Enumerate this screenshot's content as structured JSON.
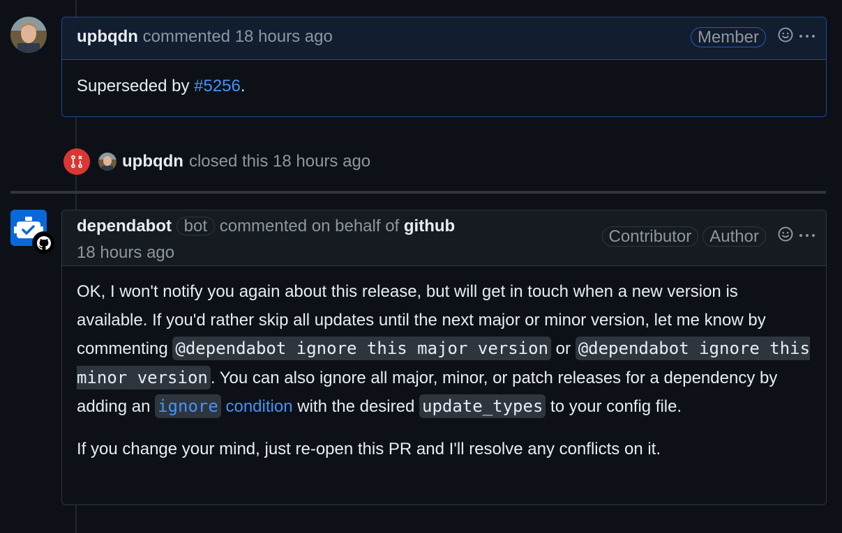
{
  "comment1": {
    "author": "upbqdn",
    "action": "commented",
    "time": "18 hours ago",
    "role": "Member",
    "body_prefix": "Superseded by ",
    "link": "#5256",
    "body_suffix": "."
  },
  "closed_event": {
    "author": "upbqdn",
    "text": "closed this 18 hours ago"
  },
  "comment2": {
    "author": "dependabot",
    "bot_label": "bot",
    "action": "commented on behalf of",
    "on_behalf": "github",
    "time": "18 hours ago",
    "role1": "Contributor",
    "role2": "Author",
    "para1": {
      "t1": "OK, I won't notify you again about this release, but will get in touch when a new version is available. If you'd rather skip all updates until the next major or minor version, let me know by commenting ",
      "code1": "@dependabot ignore this major version",
      "t2": " or ",
      "code2": "@dependabot ignore this minor version",
      "t3": ". You can also ignore all major, minor, or patch releases for a dependency by adding an ",
      "link_code": "ignore",
      "link_text": "condition",
      "t4": " with the desired ",
      "code3": "update_types",
      "t5": " to your config file."
    },
    "para2": "If you change your mind, just re-open this PR and I'll resolve any conflicts on it."
  },
  "icons": {
    "emoji": "smiley-icon",
    "more": "kebab-horizontal-icon",
    "closed": "git-pull-request-closed-icon"
  },
  "colors": {
    "background": "#0d1117",
    "link": "#4493f8",
    "closed": "#da3633",
    "member_header": "#121d2f",
    "bot_avatar": "#0969da"
  }
}
